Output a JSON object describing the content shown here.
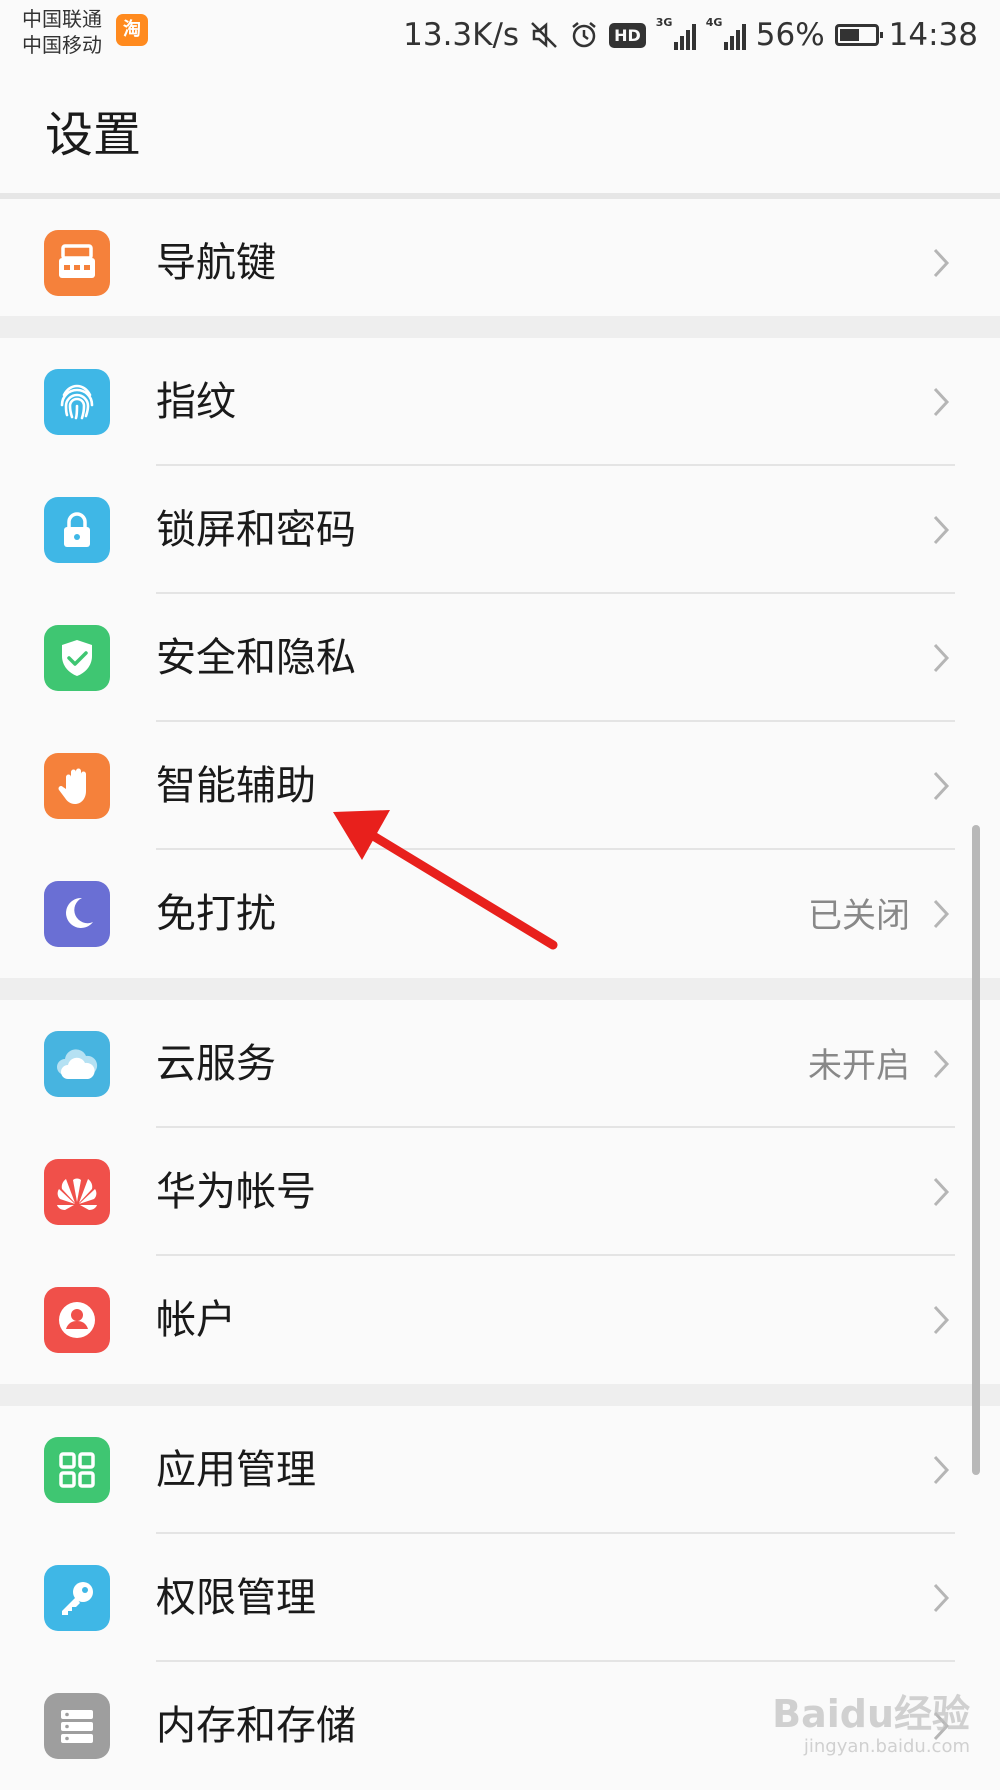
{
  "status_bar": {
    "carrier1": "中国联通",
    "carrier2": "中国移动",
    "taobao_icon": "淘",
    "speed": "13.3K/s",
    "net1": "3G",
    "net2": "4G",
    "hd": "HD",
    "battery_percent": "56%",
    "battery_level": 0.56,
    "time": "14:38"
  },
  "header": {
    "title": "设置"
  },
  "groups": [
    {
      "items": [
        {
          "label": "导航键",
          "icon": "navigation-key-icon",
          "color": "#f5813b"
        }
      ]
    },
    {
      "items": [
        {
          "label": "指纹",
          "icon": "fingerprint-icon",
          "color": "#3fb7e6"
        },
        {
          "label": "锁屏和密码",
          "icon": "lock-icon",
          "color": "#3fb7e6"
        },
        {
          "label": "安全和隐私",
          "icon": "shield-icon",
          "color": "#3fc672"
        },
        {
          "label": "智能辅助",
          "icon": "hand-icon",
          "color": "#f5813b"
        },
        {
          "label": "免打扰",
          "icon": "moon-icon",
          "color": "#6a6fd4",
          "status": "已关闭"
        }
      ]
    },
    {
      "items": [
        {
          "label": "云服务",
          "icon": "cloud-icon",
          "color": "#47b4e0",
          "status": "未开启"
        },
        {
          "label": "华为帐号",
          "icon": "huawei-logo-icon",
          "color": "#f0504a"
        },
        {
          "label": "帐户",
          "icon": "account-icon",
          "color": "#f0504a"
        }
      ]
    },
    {
      "items": [
        {
          "label": "应用管理",
          "icon": "apps-grid-icon",
          "color": "#3fc672"
        },
        {
          "label": "权限管理",
          "icon": "key-icon",
          "color": "#3fb7e6"
        },
        {
          "label": "内存和存储",
          "icon": "storage-icon",
          "color": "#9e9e9e"
        }
      ]
    }
  ],
  "watermark": {
    "main": "Baidu经验",
    "sub": "jingyan.baidu.com"
  },
  "colors": {
    "annotation_arrow": "#e8201c"
  }
}
